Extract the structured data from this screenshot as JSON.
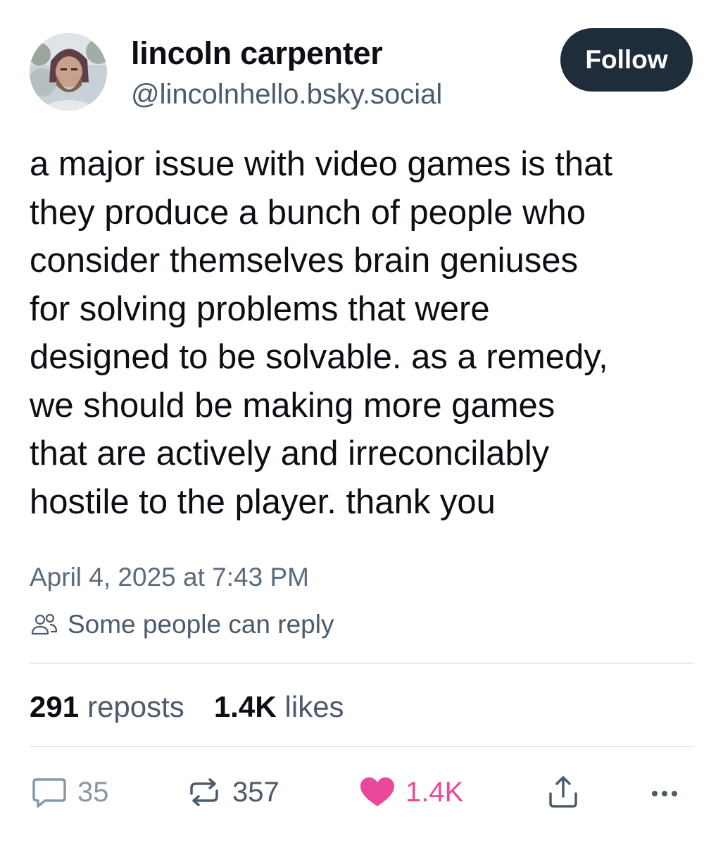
{
  "author": {
    "display_name": "lincoln carpenter",
    "handle": "@lincolnhello.bsky.social"
  },
  "follow_label": "Follow",
  "post": {
    "lines": [
      "a major issue with video games is that",
      "they produce a bunch of people who",
      "consider themselves brain geniuses",
      "for solving problems that were",
      "designed to be solvable. as a remedy,",
      "we should be making more games",
      "that are actively and irreconcilably",
      "hostile to the player. thank you"
    ],
    "timestamp": "April 4, 2025 at 7:43 PM",
    "reply_restriction": "Some people can reply"
  },
  "stats": {
    "reposts_count": "291",
    "reposts_label": "reposts",
    "likes_count": "1.4K",
    "likes_label": "likes"
  },
  "actions": {
    "reply_count": "35",
    "repost_count": "357",
    "like_count": "1.4K"
  },
  "icons": {
    "avatar": "avatar-photo",
    "reply_restriction": "people-icon",
    "reply": "speech-bubble-icon",
    "repost": "repost-arrows-icon",
    "like": "heart-icon",
    "share": "share-icon",
    "more": "ellipsis-icon"
  },
  "colors": {
    "follow_button_bg": "#1f2d3a",
    "like_active": "#ec4899",
    "secondary_text": "#4b5b6c"
  }
}
